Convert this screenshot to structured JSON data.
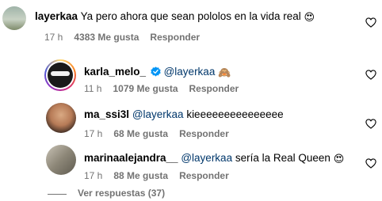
{
  "comments": [
    {
      "username": "layerkaa",
      "text": "Ya pero ahora que sean pololos en la vida real",
      "emoji": "😍",
      "time": "17 h",
      "likes": "4383 Me gusta",
      "reply": "Responder"
    },
    {
      "username": "karla_melo_",
      "mention": "@layerkaa",
      "emoji": "🙈",
      "time": "11 h",
      "likes": "1079 Me gusta",
      "reply": "Responder"
    },
    {
      "username": "ma_ssi3l",
      "mention": "@layerkaa",
      "text": "kieeeeeeeeeeeeeee",
      "time": "17 h",
      "likes": "68 Me gusta",
      "reply": "Responder"
    },
    {
      "username": "marinaalejandra__",
      "mention": "@layerkaa",
      "text": "sería la Real Queen",
      "emoji": "😍",
      "time": "17 h",
      "likes": "88 Me gusta",
      "reply": "Responder"
    }
  ],
  "more_replies": "Ver respuestas (37)",
  "colors": {
    "mention": "#00376b",
    "meta": "#737373",
    "verified": "#0095f6"
  },
  "icons": {
    "like": "heart-outline-icon",
    "verified": "verified-badge-icon"
  }
}
